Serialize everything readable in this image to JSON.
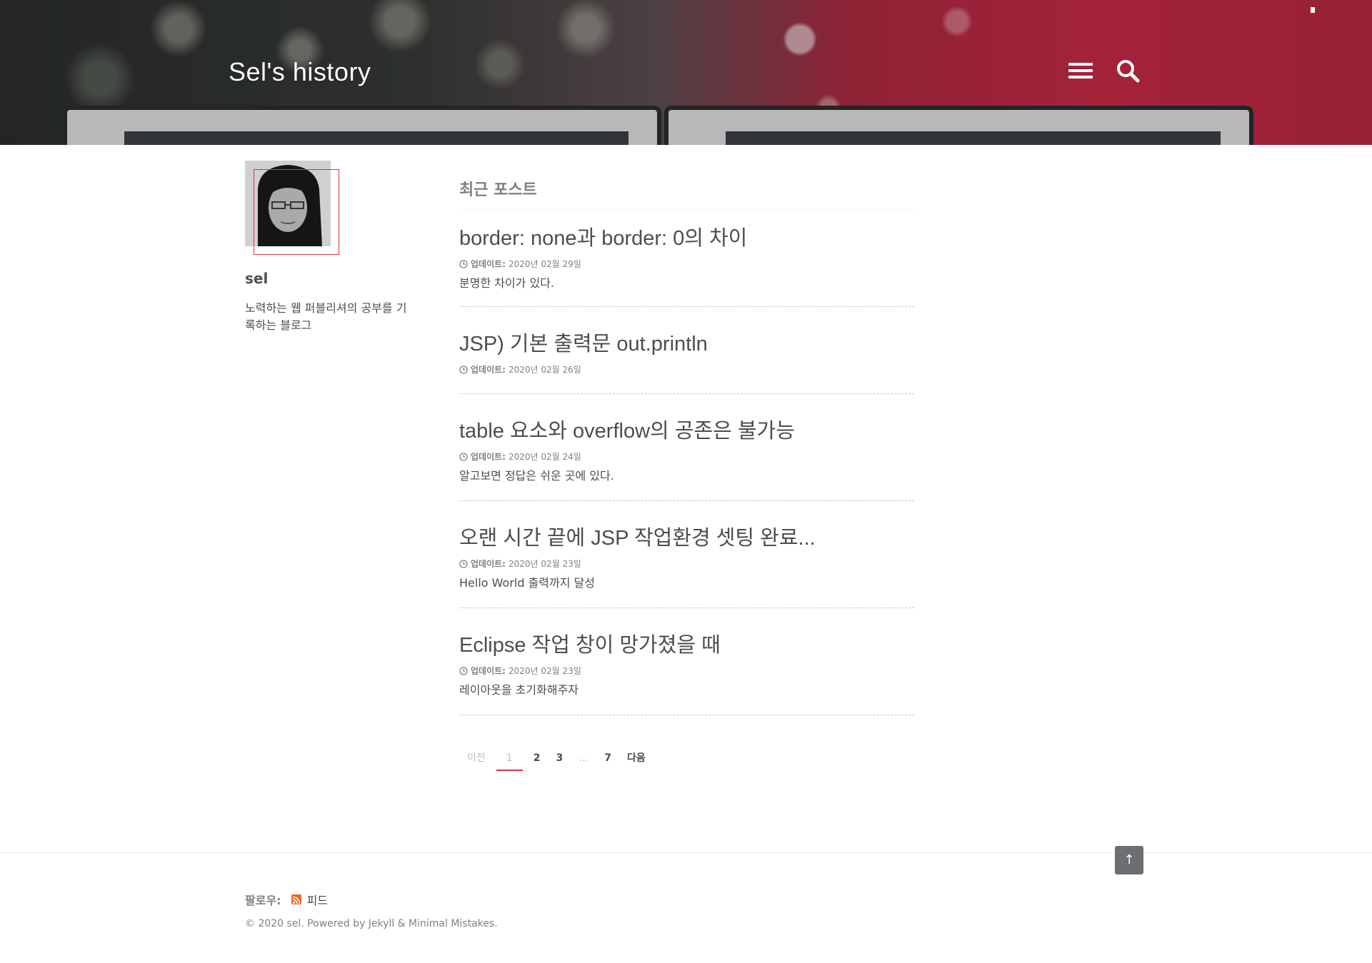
{
  "header": {
    "site_title": "Sel's history"
  },
  "author": {
    "name": "sel",
    "bio": "노력하는 웹 퍼블리셔의 공부를 기록하는 블로그"
  },
  "main": {
    "section_title": "최근 포스트",
    "updated_label": "업데이트:",
    "posts": [
      {
        "title": "border: none과 border: 0의 차이",
        "date": "2020년 02월 29일",
        "excerpt": "분명한 차이가 있다."
      },
      {
        "title": "JSP) 기본 출력문 out.println",
        "date": "2020년 02월 26일",
        "excerpt": ""
      },
      {
        "title": "table 요소와 overflow의 공존은 불가능",
        "date": "2020년 02월 24일",
        "excerpt": "알고보면 정답은 쉬운 곳에 있다."
      },
      {
        "title": "오랜 시간 끝에 JSP 작업환경 셋팅 완료...",
        "date": "2020년 02월 23일",
        "excerpt": "Hello World 출력까지 달성"
      },
      {
        "title": "Eclipse 작업 창이 망가졌을 때",
        "date": "2020년 02월 23일",
        "excerpt": "레이아웃을 초기화해주자"
      }
    ]
  },
  "pagination": {
    "prev": "이전",
    "pages": [
      "1",
      "2",
      "3",
      "…",
      "7"
    ],
    "current": "1",
    "next": "다음"
  },
  "footer": {
    "follow_label": "팔로우:",
    "feed_label": "피드",
    "copyright": "© 2020 sel. Powered by Jekyll & Minimal Mistakes.",
    "back_to_top": "↑"
  },
  "colors": {
    "accent": "#e0303f",
    "text": "#494e52",
    "muted": "#7a8288",
    "rss": "#f26522"
  }
}
